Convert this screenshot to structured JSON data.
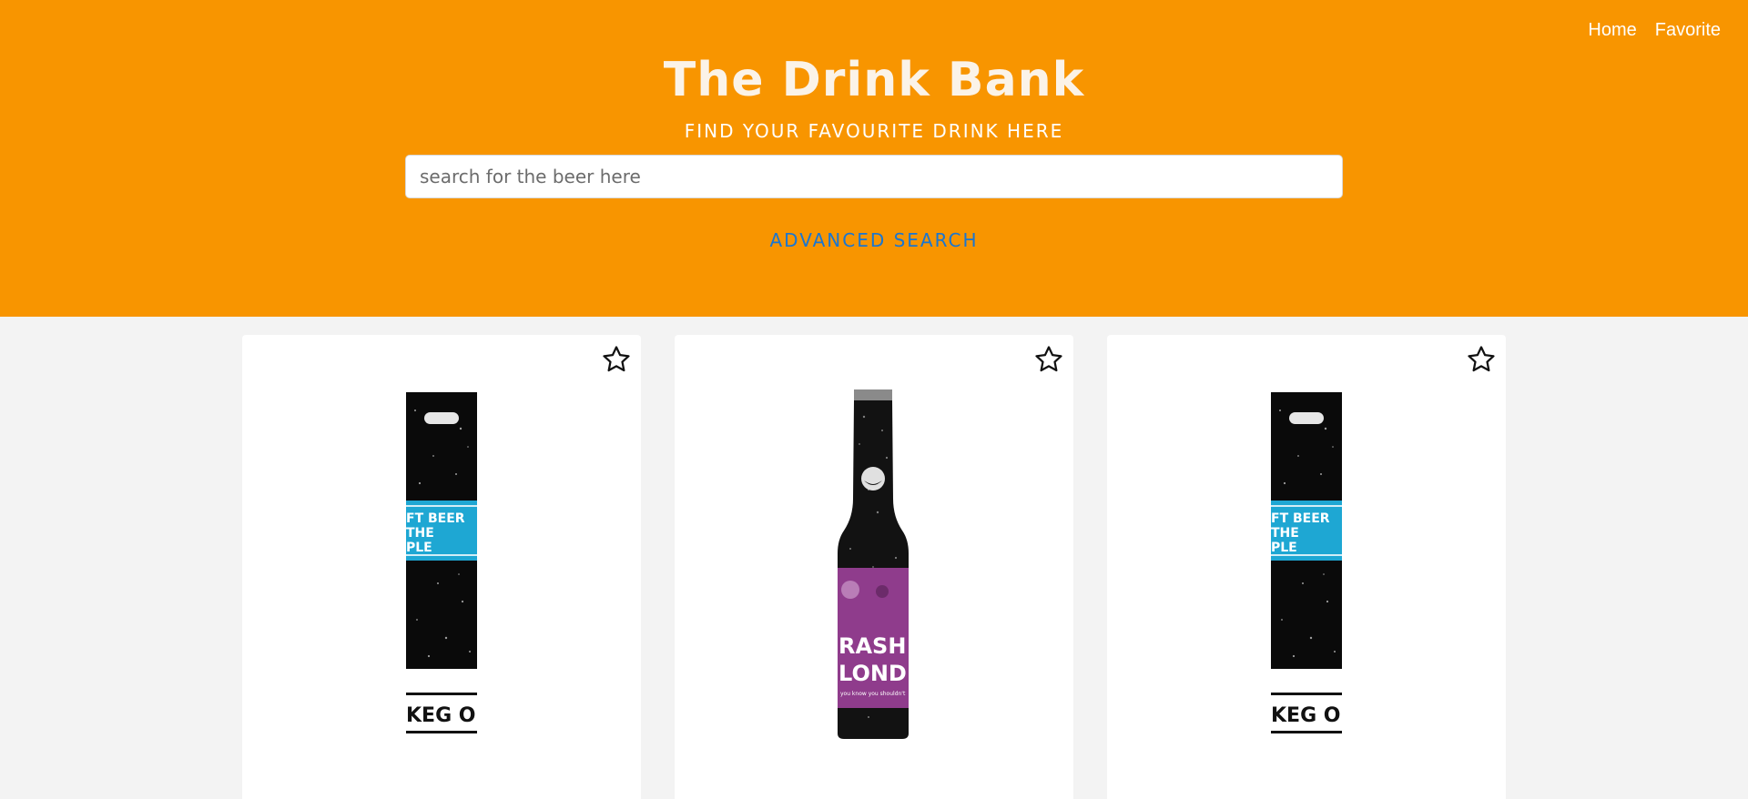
{
  "nav": {
    "home": "Home",
    "favorite": "Favorite"
  },
  "hero": {
    "title": "The Drink Bank",
    "subtitle": "FIND YOUR FAVOURITE DRINK HERE",
    "search_placeholder": "search for the beer here",
    "advanced_search": "ADVANCED SEARCH"
  },
  "cards": [
    {
      "image": "keg-only-can",
      "favorite_icon": "star-outline-icon"
    },
    {
      "image": "trashy-blonde-bottle",
      "favorite_icon": "star-outline-icon"
    },
    {
      "image": "keg-only-can",
      "favorite_icon": "star-outline-icon"
    }
  ],
  "image_text": {
    "craft_line1": "FT BEER",
    "craft_line2": "THE",
    "craft_line3": "PLE",
    "keg": "KEG ONLY",
    "label1": "RASH",
    "label2": "LONDE",
    "label3": "you know you shouldn't"
  },
  "colors": {
    "accent": "#f89500",
    "link": "#1976d2",
    "page_bg": "#f3f3f3"
  }
}
